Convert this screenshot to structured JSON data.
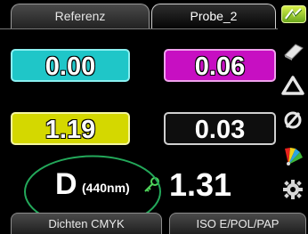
{
  "tabs": [
    {
      "label": "Referenz",
      "active": false
    },
    {
      "label": "Probe_2",
      "active": true
    }
  ],
  "measurements": {
    "cyan": "0.00",
    "magenta": "0.06",
    "yellow": "1.19",
    "black": "0.03"
  },
  "density": {
    "label": "D",
    "wavelength": "(440nm)",
    "value": "1.31"
  },
  "footer": {
    "left": "Dichten CMYK",
    "right": "ISO E/POL/PAP"
  },
  "colors": {
    "cyan": "#1fc6c8",
    "magenta": "#c70fc2",
    "yellow": "#d4d800",
    "black": "#0e0e0e",
    "highlight": "#23a85a"
  },
  "icons": [
    "battery-icon",
    "arrow-icon",
    "triangle-icon",
    "no-filter-icon",
    "color-fan-icon",
    "gear-icon",
    "key-icon"
  ]
}
